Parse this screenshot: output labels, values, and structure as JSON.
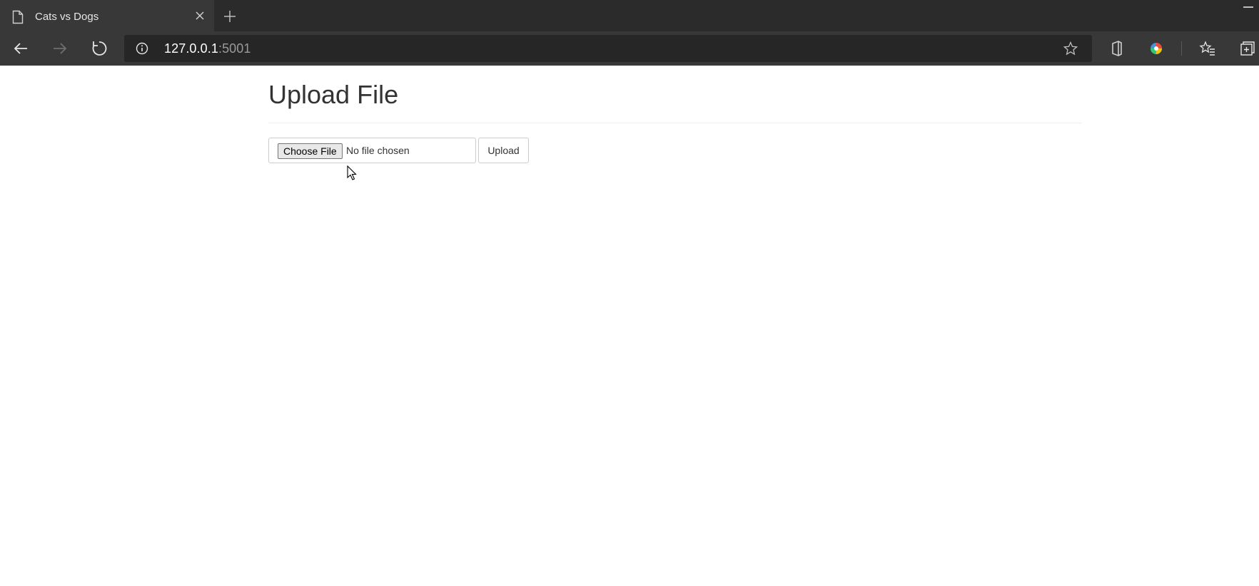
{
  "browser": {
    "tab": {
      "title": "Cats vs Dogs"
    },
    "address_bar": {
      "host": "127.0.0.1",
      "port": ":5001"
    }
  },
  "page": {
    "title": "Upload File",
    "file_input": {
      "button_label": "Choose File",
      "status": "No file chosen"
    },
    "upload_button": "Upload"
  },
  "colors": {
    "tabstrip_bg": "#2b2b2b",
    "toolbar_bg": "#383838",
    "omnibox_bg": "#262626",
    "page_bg": "#ffffff"
  },
  "icons": [
    "page-icon",
    "close-icon",
    "plus-icon",
    "back-arrow-icon",
    "forward-arrow-icon",
    "refresh-icon",
    "info-icon",
    "star-icon",
    "office-icon",
    "color-wheel-icon",
    "favorites-icon",
    "collections-icon",
    "mouse-cursor-icon"
  ]
}
